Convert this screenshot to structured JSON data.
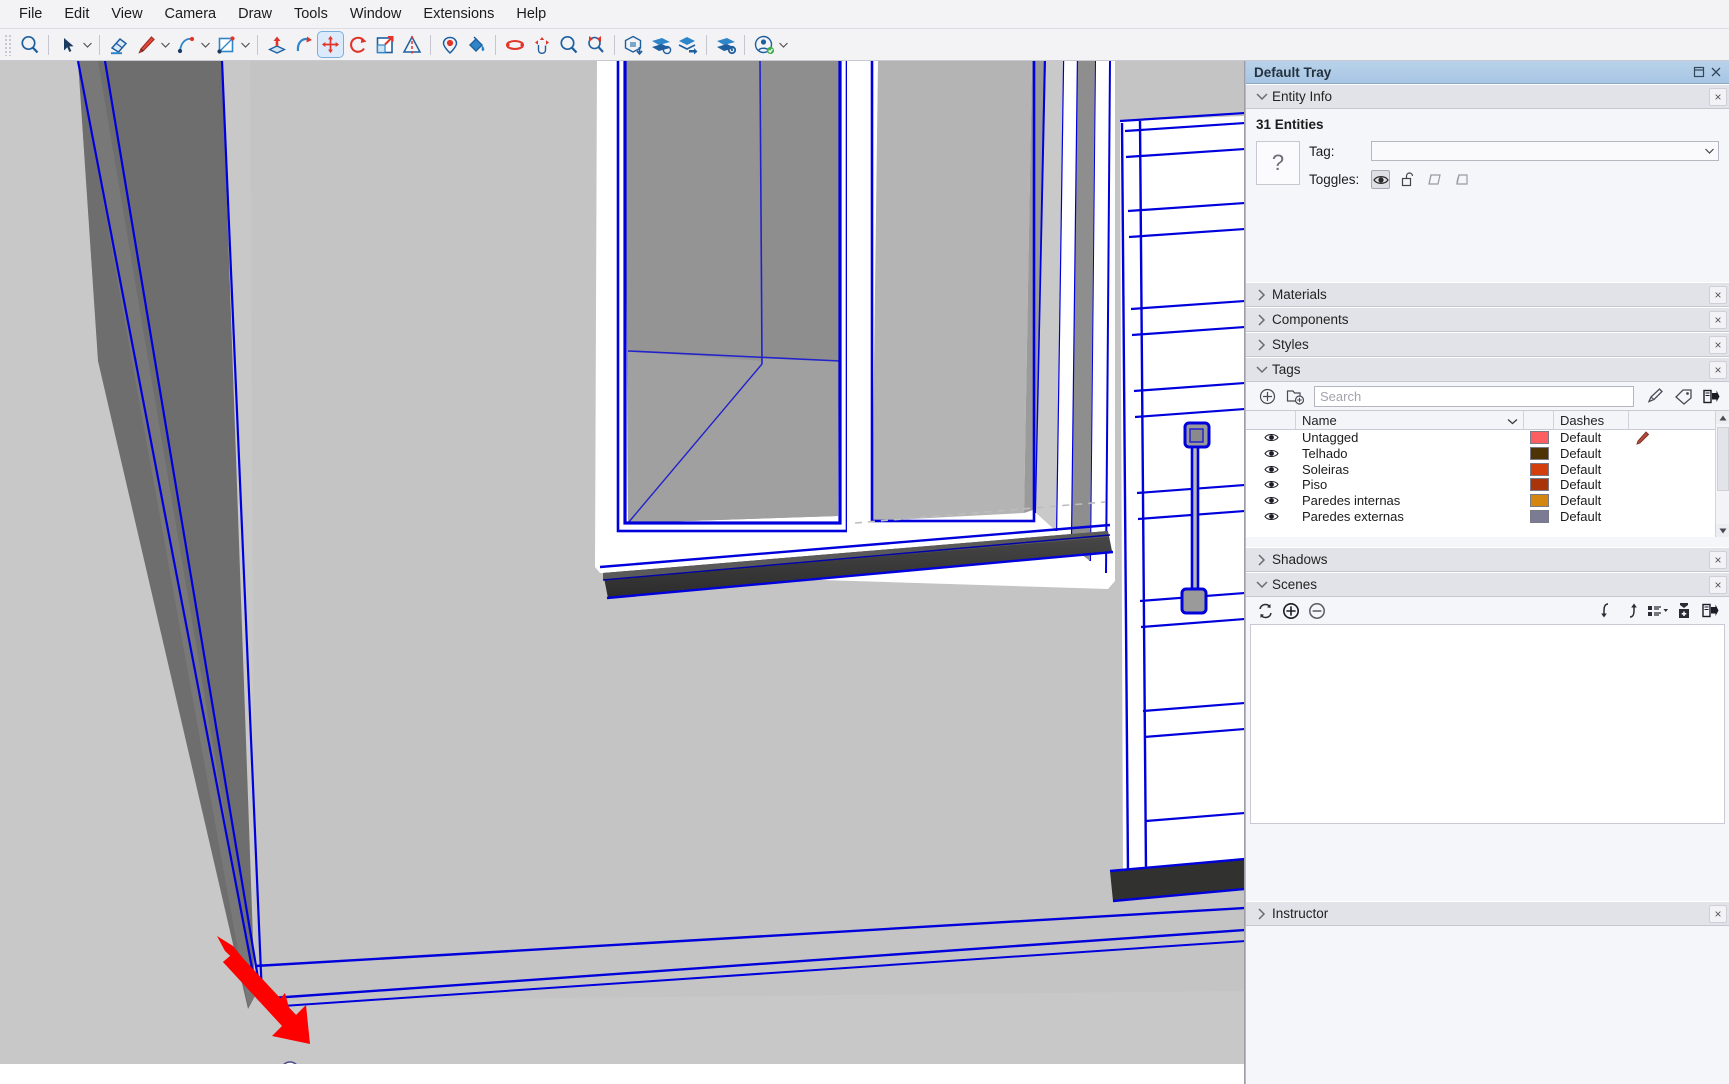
{
  "menubar": {
    "items": [
      {
        "label": "File"
      },
      {
        "label": "Edit"
      },
      {
        "label": "View"
      },
      {
        "label": "Camera"
      },
      {
        "label": "Draw"
      },
      {
        "label": "Tools"
      },
      {
        "label": "Window"
      },
      {
        "label": "Extensions"
      },
      {
        "label": "Help"
      }
    ]
  },
  "toolbar": {
    "items": [
      {
        "name": "zoom-extents-magnifier-icon",
        "tooltip": "Zoom"
      },
      {
        "name": "select-arrow-icon",
        "tooltip": "Select"
      },
      {
        "name": "select-dropdown-icon",
        "tooltip": "Select options"
      },
      {
        "name": "eraser-icon",
        "tooltip": "Eraser"
      },
      {
        "name": "line-pencil-icon",
        "tooltip": "Line"
      },
      {
        "name": "line-dropdown-icon",
        "tooltip": "Line options"
      },
      {
        "name": "arc-icon",
        "tooltip": "Arc"
      },
      {
        "name": "arc-dropdown-icon",
        "tooltip": "Arc options"
      },
      {
        "name": "rectangle-icon",
        "tooltip": "Rectangle"
      },
      {
        "name": "rectangle-dropdown-icon",
        "tooltip": "Shapes options"
      },
      {
        "name": "pushpull-icon",
        "tooltip": "Push/Pull"
      },
      {
        "name": "followme-icon",
        "tooltip": "Follow Me"
      },
      {
        "name": "move-icon",
        "tooltip": "Move",
        "active": true
      },
      {
        "name": "rotate-icon",
        "tooltip": "Rotate"
      },
      {
        "name": "scale-icon",
        "tooltip": "Scale"
      },
      {
        "name": "tape-measure-icon",
        "tooltip": "Tape Measure"
      },
      {
        "name": "position-camera-icon",
        "tooltip": "Position Camera"
      },
      {
        "name": "paint-bucket-icon",
        "tooltip": "Paint Bucket"
      },
      {
        "name": "orbit-icon",
        "tooltip": "Orbit"
      },
      {
        "name": "pan-hand-icon",
        "tooltip": "Pan"
      },
      {
        "name": "zoom-icon",
        "tooltip": "Zoom"
      },
      {
        "name": "zoom-extents-icon",
        "tooltip": "Zoom Extents"
      },
      {
        "name": "model-info-icon",
        "tooltip": "Model Info"
      },
      {
        "name": "section-plane-icon",
        "tooltip": "Section Plane"
      },
      {
        "name": "layers-export-icon",
        "tooltip": "Layers"
      },
      {
        "name": "settings-layers-icon",
        "tooltip": "Settings"
      },
      {
        "name": "user-account-icon",
        "tooltip": "Account"
      },
      {
        "name": "user-dropdown-icon",
        "tooltip": "Account options"
      }
    ]
  },
  "viewport": {
    "annotation": "red-arrow-pointing-to-corner-vertex",
    "endpoint_marker": "endpoint-inference-point",
    "background_color": "#c8c8c8",
    "edge_color": "#0000ff",
    "face_color": "#c0c0c0"
  },
  "tray": {
    "title": "Default Tray",
    "title_buttons": [
      "restore-icon",
      "close-icon"
    ],
    "panels": [
      {
        "id": "entity_info",
        "label": "Entity Info",
        "expanded": true,
        "close_label": "×",
        "entities_count": "31 Entities",
        "thumbnail_glyph": "?",
        "tag_label": "Tag:",
        "tag_value": "",
        "toggles_label": "Toggles:",
        "toggles": [
          {
            "name": "visible-eye-icon",
            "selected": true
          },
          {
            "name": "unlocked-padlock-icon",
            "selected": false
          },
          {
            "name": "receives-shadows-icon",
            "selected": false
          },
          {
            "name": "casts-shadows-icon",
            "selected": false
          }
        ]
      },
      {
        "id": "materials",
        "label": "Materials",
        "expanded": false,
        "close_label": "×"
      },
      {
        "id": "components",
        "label": "Components",
        "expanded": false,
        "close_label": "×"
      },
      {
        "id": "styles",
        "label": "Styles",
        "expanded": false,
        "close_label": "×"
      },
      {
        "id": "tags",
        "label": "Tags",
        "expanded": true,
        "close_label": "×",
        "toolbar": [
          {
            "name": "add-tag-icon"
          },
          {
            "name": "add-tag-folder-icon"
          },
          {
            "name": "select-all-tag-icon"
          },
          {
            "name": "tag-color-icon"
          },
          {
            "name": "tags-details-icon"
          }
        ],
        "search_placeholder": "Search",
        "search_value": "",
        "columns": [
          "",
          "Name",
          "",
          "Dashes",
          ""
        ],
        "rows": [
          {
            "visible": true,
            "name": "Untagged",
            "color": "#fb5f62",
            "dashes": "Default",
            "active": true
          },
          {
            "visible": true,
            "name": "Telhado",
            "color": "#4e3404",
            "dashes": "Default",
            "active": false
          },
          {
            "visible": true,
            "name": "Soleiras",
            "color": "#d23f0c",
            "dashes": "Default",
            "active": false
          },
          {
            "visible": true,
            "name": "Piso",
            "color": "#a93409",
            "dashes": "Default",
            "active": false
          },
          {
            "visible": true,
            "name": "Paredes internas",
            "color": "#d4870f",
            "dashes": "Default",
            "active": false
          },
          {
            "visible": true,
            "name": "Paredes externas",
            "color": "#7b7b93",
            "dashes": "Default",
            "active": false
          }
        ]
      },
      {
        "id": "shadows",
        "label": "Shadows",
        "expanded": false,
        "close_label": "×"
      },
      {
        "id": "scenes",
        "label": "Scenes",
        "expanded": true,
        "close_label": "×",
        "toolbar_left": [
          {
            "name": "refresh-scene-icon"
          },
          {
            "name": "add-scene-icon"
          },
          {
            "name": "remove-scene-icon"
          }
        ],
        "toolbar_right": [
          {
            "name": "move-scene-down-icon"
          },
          {
            "name": "move-scene-up-icon"
          },
          {
            "name": "view-options-icon"
          },
          {
            "name": "scene-thumbnail-icon"
          },
          {
            "name": "scene-details-icon"
          }
        ],
        "items": []
      },
      {
        "id": "instructor",
        "label": "Instructor",
        "expanded": false,
        "close_label": "×"
      }
    ]
  }
}
